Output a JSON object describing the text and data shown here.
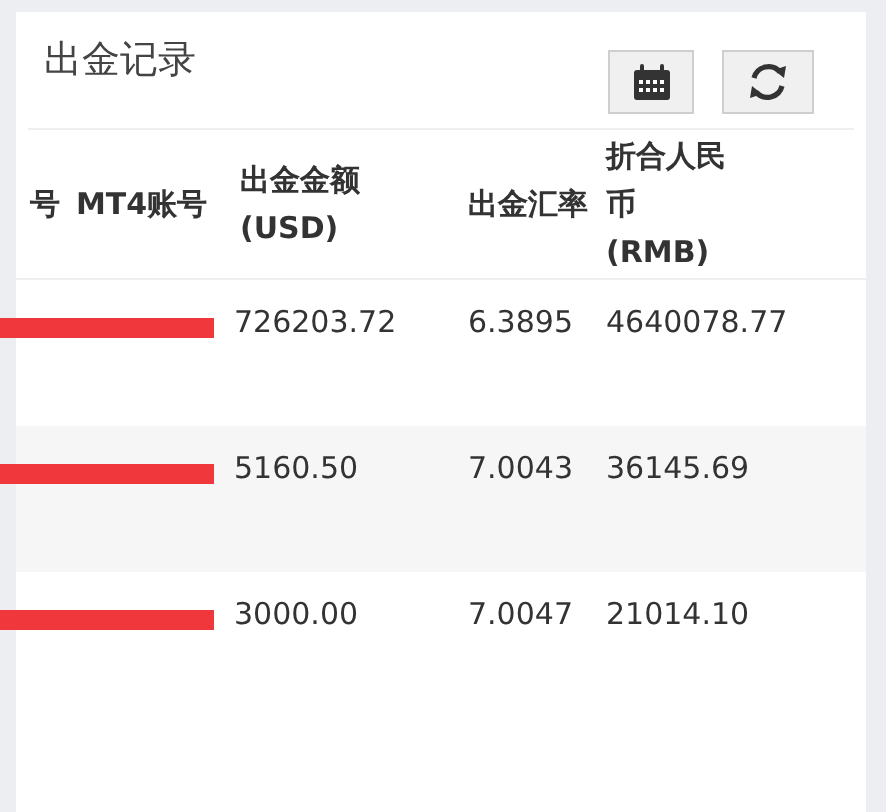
{
  "title": "出金记录",
  "toolbar": [
    {
      "kind": "calendar"
    },
    {
      "kind": "refresh"
    }
  ],
  "table": {
    "columns": [
      "号",
      "MT4账号",
      "出金金额 (USD)",
      "出金汇率",
      "折合人民币 (RMB)"
    ],
    "rows": [
      {
        "redacted": true,
        "amount_usd": "726203.72",
        "rate": "6.3895",
        "amount_rmb": "4640078.77"
      },
      {
        "redacted": true,
        "amount_usd": "5160.50",
        "rate": "7.0043",
        "amount_rmb": "36145.69"
      },
      {
        "redacted": true,
        "amount_usd": "3000.00",
        "rate": "7.0047",
        "amount_rmb": "21014.10"
      }
    ]
  }
}
